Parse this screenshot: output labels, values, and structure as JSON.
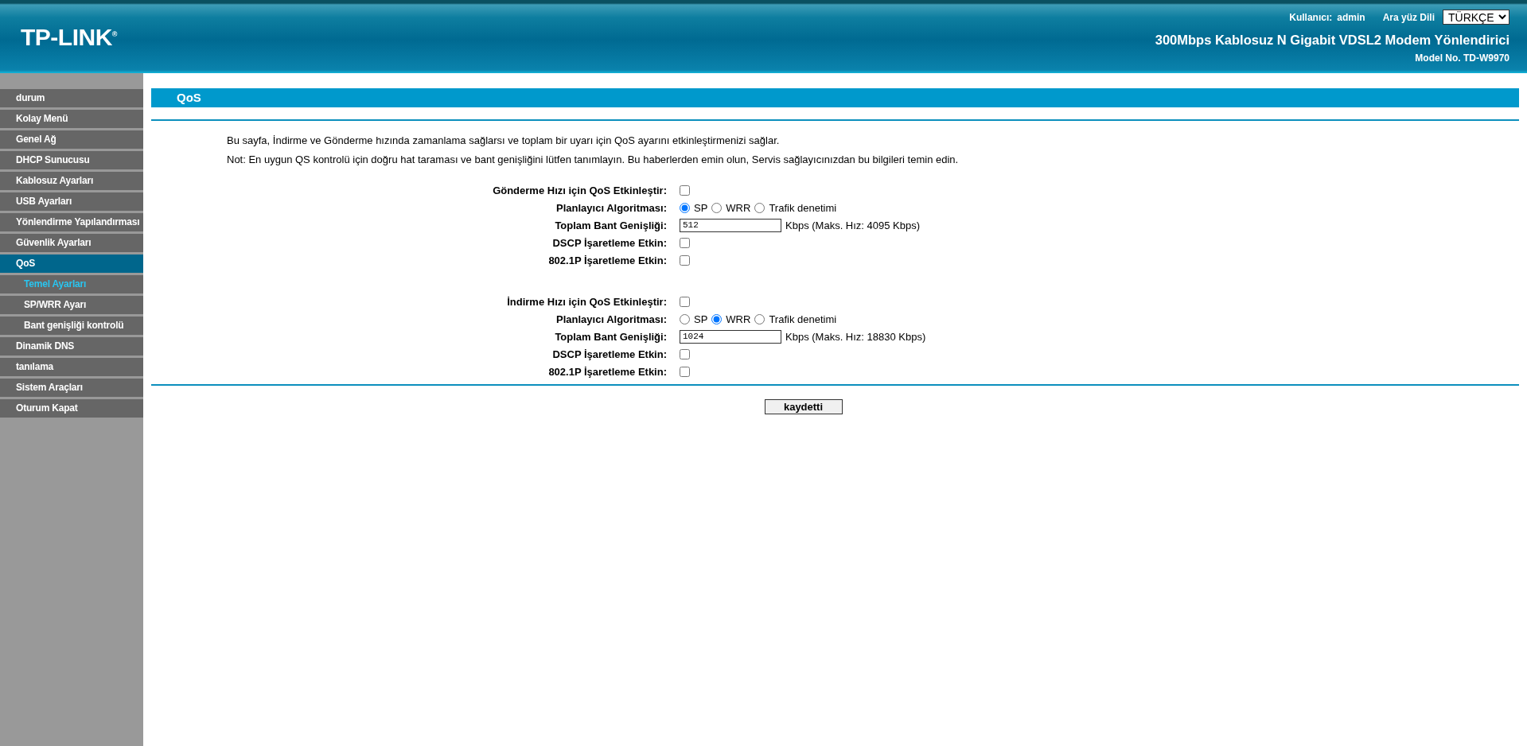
{
  "header": {
    "logo": "TP-LINK$^{®}$",
    "user_label": "Kullanıcı:",
    "user": "admin",
    "language_label": "Ara yüz Dili",
    "language": "TÜRKÇE",
    "product": "300Mbps Kablosuz N Gigabit VDSL2 Modem Yönlendirici",
    "model": "Model No. TD-W9970"
  },
  "sidebar": {
    "items": [
      {
        "label": "durum",
        "selected": false
      },
      {
        "label": "Kolay Menü",
        "selected": false
      },
      {
        "label": "Genel Ağ",
        "selected": false
      },
      {
        "label": "DHCP Sunucusu",
        "selected": false
      },
      {
        "label": "Kablosuz Ayarları",
        "selected": false
      },
      {
        "label": "USB Ayarları",
        "selected": false
      },
      {
        "label": "Yönlendirme Yapılandırması",
        "selected": false
      },
      {
        "label": "Güvenlik Ayarları",
        "selected": false
      },
      {
        "label": "QoS",
        "selected": true,
        "children": [
          {
            "label": "Temel Ayarları",
            "selected": true
          },
          {
            "label": "SP/WRR Ayarı",
            "selected": false
          },
          {
            "label": "Bant genişliği kontrolü",
            "selected": false
          }
        ]
      },
      {
        "label": "Dinamik DNS",
        "selected": false
      },
      {
        "label": "tanılama",
        "selected": false
      },
      {
        "label": "Sistem Araçları",
        "selected": false
      },
      {
        "label": "Oturum Kapat",
        "selected": false
      }
    ]
  },
  "page": {
    "title": "QoS",
    "notes": [
      "Bu sayfa, İndirme ve Gönderme hızında zamanlama sağlarsı ve toplam bir uyarı için QoS ayarını etkinleştirmenizi sağlar.",
      "Not: En uygun QS kontrolü için doğru hat taraması ve bant genişliğini lütfen tanımlayın. Bu haberlerden emin olun, Servis sağlayıcınızdan bu bilgileri temin edin."
    ],
    "sections": [
      {
        "fields": [
          {
            "kind": "checkbox",
            "label": "Gönderme Hızı için QoS Etkinleştir:",
            "checked": false
          },
          {
            "kind": "radio",
            "label": "Planlayıcı Algoritması:",
            "options": [
              {
                "label": "SP",
                "selected": true
              },
              {
                "label": "WRR",
                "selected": false
              },
              {
                "label": "Trafik denetimi",
                "selected": false
              }
            ]
          },
          {
            "kind": "text",
            "label": "Toplam Bant Genişliği:",
            "value": "512",
            "hint": "Kbps (Maks. Hız: 4095 Kbps)"
          },
          {
            "kind": "checkbox",
            "label": "DSCP İşaretleme Etkin:",
            "checked": false
          },
          {
            "kind": "checkbox",
            "label": "802.1P İşaretleme Etkin:",
            "checked": false
          }
        ]
      },
      {
        "fields": [
          {
            "kind": "checkbox",
            "label": "İndirme Hızı için QoS Etkinleştir:",
            "checked": false
          },
          {
            "kind": "radio",
            "label": "Planlayıcı Algoritması:",
            "options": [
              {
                "label": "SP",
                "selected": false
              },
              {
                "label": "WRR",
                "selected": true
              },
              {
                "label": "Trafik denetimi",
                "selected": false
              }
            ]
          },
          {
            "kind": "text",
            "label": "Toplam Bant Genişliği:",
            "value": "1024",
            "hint": "Kbps (Maks. Hız: 18830 Kbps)"
          },
          {
            "kind": "checkbox",
            "label": "DSCP İşaretleme Etkin:",
            "checked": false
          },
          {
            "kind": "checkbox",
            "label": "802.1P İşaretleme Etkin:",
            "checked": false
          }
        ]
      }
    ],
    "save_button": "kaydetti"
  }
}
